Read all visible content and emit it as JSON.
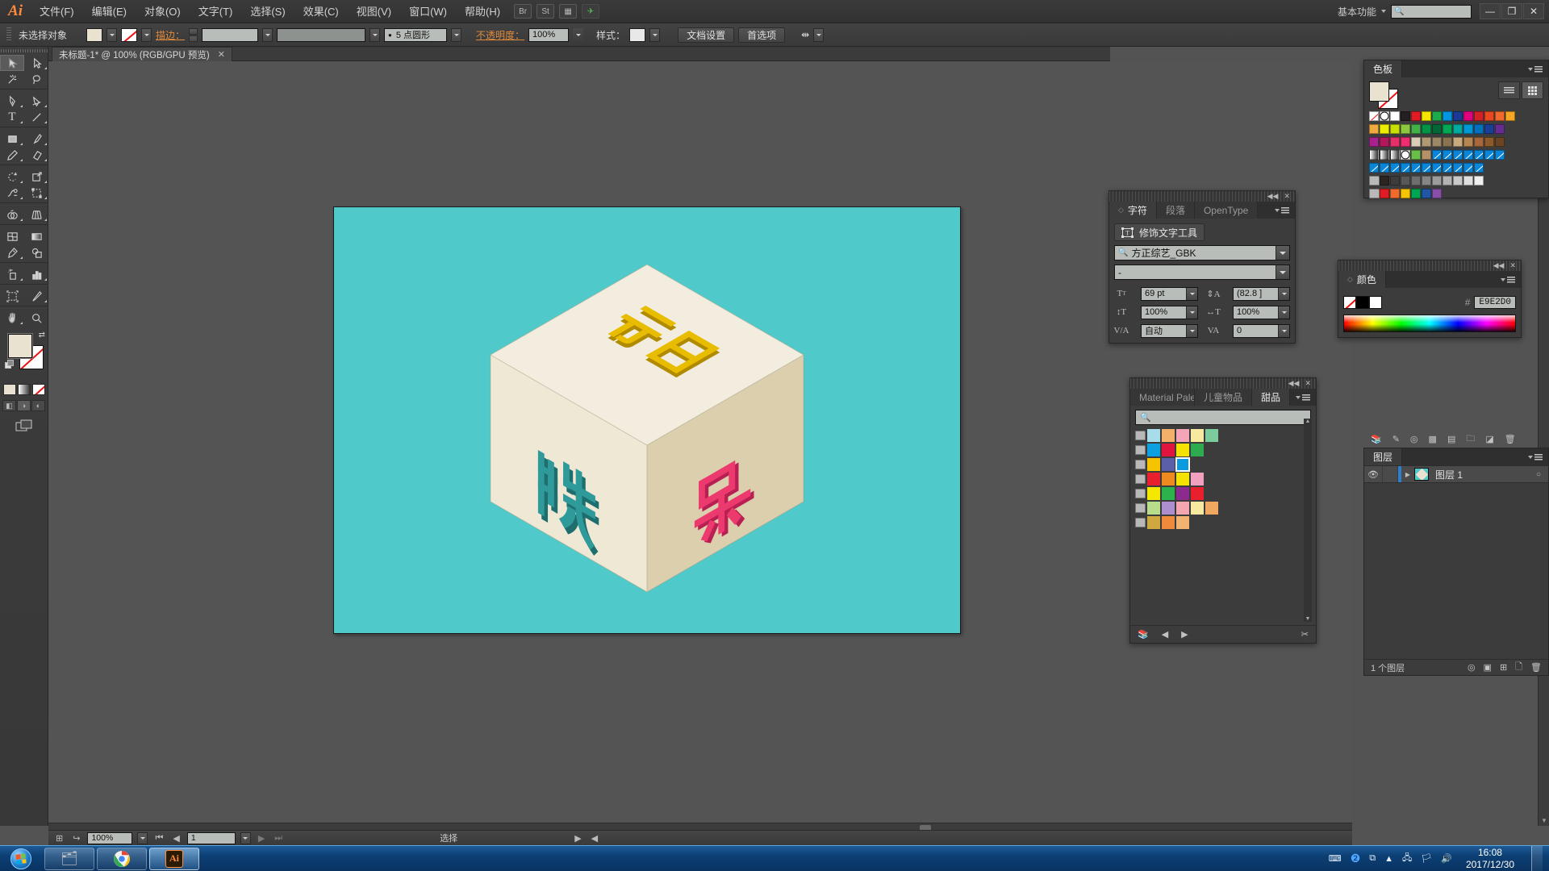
{
  "app": {
    "logo": "Ai",
    "menus": [
      "文件(F)",
      "编辑(E)",
      "对象(O)",
      "文字(T)",
      "选择(S)",
      "效果(C)",
      "视图(V)",
      "窗口(W)",
      "帮助(H)"
    ],
    "bridge_button": "Br",
    "stock_button": "St",
    "workspace": "基本功能",
    "search_placeholder": "",
    "minimize": "—",
    "maximize": "❐",
    "close": "✕"
  },
  "control_bar": {
    "selection_status": "未选择对象",
    "stroke_label": "描边：",
    "stroke_weight": "5 点圆形",
    "opacity_label": "不透明度：",
    "opacity_value": "100%",
    "style_label": "样式：",
    "document_setup": "文档设置",
    "preferences": "首选项"
  },
  "document": {
    "tab_title": "未标题-1* @ 100% (RGB/GPU 预览)",
    "close_glyph": "✕"
  },
  "toolbar": {
    "tools": [
      {
        "name": "selection-tool",
        "glyph": "➤",
        "selected": true
      },
      {
        "name": "direct-selection-tool",
        "glyph": "➤",
        "selected": false
      },
      {
        "name": "magic-wand-tool",
        "glyph": "✳",
        "selected": false
      },
      {
        "name": "lasso-tool",
        "glyph": "◠",
        "selected": false
      },
      {
        "name": "pen-tool",
        "glyph": "✒",
        "selected": false
      },
      {
        "name": "curvature-tool",
        "glyph": "✎",
        "selected": false
      },
      {
        "name": "type-tool",
        "glyph": "T",
        "selected": false
      },
      {
        "name": "line-segment-tool",
        "glyph": "╱",
        "selected": false
      },
      {
        "name": "rectangle-tool",
        "glyph": "▭",
        "selected": false
      },
      {
        "name": "paintbrush-tool",
        "glyph": "🖌",
        "selected": false
      },
      {
        "name": "pencil-tool",
        "glyph": "✐",
        "selected": false
      },
      {
        "name": "eraser-tool",
        "glyph": "▱",
        "selected": false
      },
      {
        "name": "rotate-tool",
        "glyph": "↻",
        "selected": false
      },
      {
        "name": "scale-tool",
        "glyph": "⤢",
        "selected": false
      },
      {
        "name": "width-tool",
        "glyph": "⌇",
        "selected": false
      },
      {
        "name": "free-transform-tool",
        "glyph": "⛶",
        "selected": false
      },
      {
        "name": "shape-builder-tool",
        "glyph": "◕",
        "selected": false
      },
      {
        "name": "perspective-grid-tool",
        "glyph": "▦",
        "selected": false
      },
      {
        "name": "mesh-tool",
        "glyph": "▨",
        "selected": false
      },
      {
        "name": "gradient-tool",
        "glyph": "▬",
        "selected": false
      },
      {
        "name": "eyedropper-tool",
        "glyph": "✐",
        "selected": false
      },
      {
        "name": "blend-tool",
        "glyph": "◍",
        "selected": false
      },
      {
        "name": "symbol-sprayer-tool",
        "glyph": "⬚",
        "selected": false
      },
      {
        "name": "column-graph-tool",
        "glyph": "▥",
        "selected": false
      },
      {
        "name": "artboard-tool",
        "glyph": "⬚",
        "selected": false
      },
      {
        "name": "slice-tool",
        "glyph": "✂",
        "selected": false
      },
      {
        "name": "hand-tool",
        "glyph": "✋",
        "selected": false
      },
      {
        "name": "zoom-tool",
        "glyph": "🔍",
        "selected": false
      }
    ],
    "fill_color": "#E9E2D0",
    "stroke_color": "none"
  },
  "canvas": {
    "artboard_color": "#4FC9C9",
    "artwork": {
      "description": "isometric-cube",
      "top_text": "元旦",
      "left_text": "快",
      "right_text": "乐",
      "top_text_color": "#E0B400",
      "left_text_color": "#2E8B8B",
      "right_text_color": "#E8366B",
      "cube_top_color": "#F1ECDC",
      "cube_left_color": "#EFE8D6",
      "cube_right_color": "#DCD0B0"
    }
  },
  "character_panel": {
    "tabs": [
      "字符",
      "段落",
      "OpenType"
    ],
    "active_tab": "字符",
    "touch_type_tool": "修饰文字工具",
    "font_family": "方正综艺_GBK",
    "font_style": "-",
    "font_size": "69 pt",
    "leading": "(82.8 ]",
    "vertical_scale": "100%",
    "horizontal_scale": "100%",
    "kerning": "自动",
    "tracking": "0"
  },
  "color_panel": {
    "title": "颜色",
    "hex_symbol": "#",
    "hex_value": "E9E2D0"
  },
  "swatches_panel": {
    "title": "色板",
    "rows": [
      [
        "none",
        "reg",
        "#ffffff",
        "#231f20",
        "#e01b24",
        "#f5e500",
        "#1eab4b",
        "#0096e0",
        "#1b3a96",
        "#e0007f",
        "#d42027",
        "#e8491e",
        "#ef6a2c",
        "#f5a623"
      ],
      [
        "#f0a93c",
        "#eded00",
        "#c9e000",
        "#8dc63f",
        "#43b049",
        "#009245",
        "#006837",
        "#00a651",
        "#00a99d",
        "#0099d8",
        "#0071bc",
        "#1b3f94",
        "#662d91"
      ],
      [
        "#a8218e",
        "#b3185d",
        "#e62e6b",
        "#ec2d6f",
        "#d9cdb8",
        "#b09a76",
        "#9c8866",
        "#8a7351",
        "#c9a97e",
        "#b5864f",
        "#a8673a",
        "#8c5a2b",
        "#6b4423"
      ],
      [
        "grad",
        "grad",
        "grad",
        "reg",
        "#6abf4b",
        "#b5926a",
        "diag",
        "diag",
        "diag",
        "diag",
        "diag",
        "diag",
        "diag"
      ],
      [
        "diag",
        "diag",
        "diag",
        "diag",
        "diag",
        "diag",
        "diag",
        "diag",
        "diag",
        "diag",
        "diag",
        "",
        ""
      ],
      [
        "folder",
        "#2b2420",
        "#3c3c3c",
        "#585858",
        "#6e6e6e",
        "#858585",
        "#9c9c9c",
        "#b3b3b3",
        "#c9c9c9",
        "#e0e0e0",
        "#f0f0f0",
        "",
        ""
      ],
      [
        "folder",
        "#e01b24",
        "#ef6a2c",
        "#f5c400",
        "#00a651",
        "#2255a4",
        "#8a4fa8",
        "",
        "",
        "",
        "",
        "",
        ""
      ]
    ]
  },
  "material_panel": {
    "tabs": [
      "Material Palette",
      "儿童物品",
      "甜品"
    ],
    "active_tab": "甜品",
    "search_placeholder": "",
    "swatch_rows": [
      [
        "#a8dcea",
        "#f3b06a",
        "#f4a6b8",
        "#f7eaa0",
        "#7ccb9c"
      ],
      [
        "#0d9fe0",
        "#e0143c",
        "#f5e200",
        "#2eab4f"
      ],
      [
        "#f5c300",
        "#5a5fa8",
        "#0b9ae0"
      ],
      [
        "#e8202e",
        "#ef8a20",
        "#f5e200",
        "#f2a0c0"
      ],
      [
        "#f5e800",
        "#2bb24c",
        "#8c2a8e",
        "#e8202e"
      ],
      [
        "#b7dd8a",
        "#ad8fd0",
        "#f4a6b0",
        "#f7eaa0",
        "#f0a860"
      ],
      [
        "#cfa93f",
        "#ef8a3c",
        "#f0b470"
      ]
    ],
    "selected_index": [
      2,
      2
    ]
  },
  "layers_panel": {
    "title": "图层",
    "layer_name": "图层 1",
    "count_label": "1 个图层"
  },
  "status_bar": {
    "zoom": "100%",
    "page": "1",
    "tool_status": "选择"
  },
  "taskbar": {
    "items": [
      {
        "name": "windows-explorer",
        "glyph": "🗂"
      },
      {
        "name": "google-chrome",
        "glyph": "◉"
      },
      {
        "name": "adobe-illustrator",
        "glyph": "Ai"
      }
    ],
    "tray_icons": [
      "keyboard-icon",
      "help-icon",
      "windows-update-icon",
      "show-hidden-icon",
      "network-icon",
      "security-icon",
      "volume-icon"
    ],
    "time": "16:08",
    "date": "2017/12/30"
  }
}
